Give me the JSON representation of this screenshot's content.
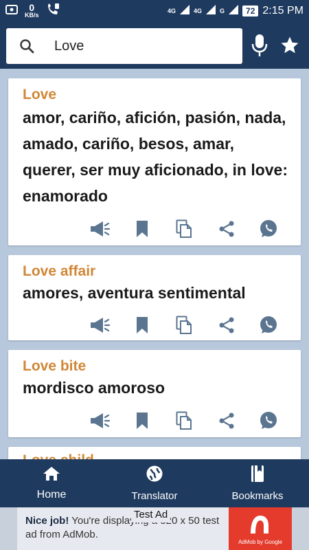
{
  "status_bar": {
    "speed_value": "0",
    "speed_unit": "KB/s",
    "network_1": "4G",
    "network_2": "4G",
    "network_3": "G",
    "battery": "72",
    "time": "2:15 PM"
  },
  "search": {
    "value": "Love",
    "placeholder": ""
  },
  "results": [
    {
      "term": "Love",
      "translation": "amor, cariño, afición, pasión, nada, amado, cariño, besos, amar, querer, ser muy aficionado, in love: enamorado"
    },
    {
      "term": "Love affair",
      "translation": "amores, aventura sentimental"
    },
    {
      "term": "Love bite",
      "translation": "mordisco amoroso"
    },
    {
      "term": "Love child",
      "translation": ""
    }
  ],
  "bottom_nav": {
    "items": [
      {
        "label": "Home",
        "icon": "home-icon"
      },
      {
        "label": "Translator",
        "icon": "globe-icon"
      },
      {
        "label": "Bookmarks",
        "icon": "book-icon"
      }
    ]
  },
  "ad": {
    "label": "Test Ad",
    "headline": "Nice job!",
    "body": " You're displaying a 320 x 50 test ad from AdMob.",
    "brand": "AdMob by Google"
  },
  "colors": {
    "primary": "#1e3a5f",
    "background": "#b7c7dc",
    "term": "#d08736",
    "icon": "#5b7590",
    "ad_red": "#e43b2d"
  }
}
